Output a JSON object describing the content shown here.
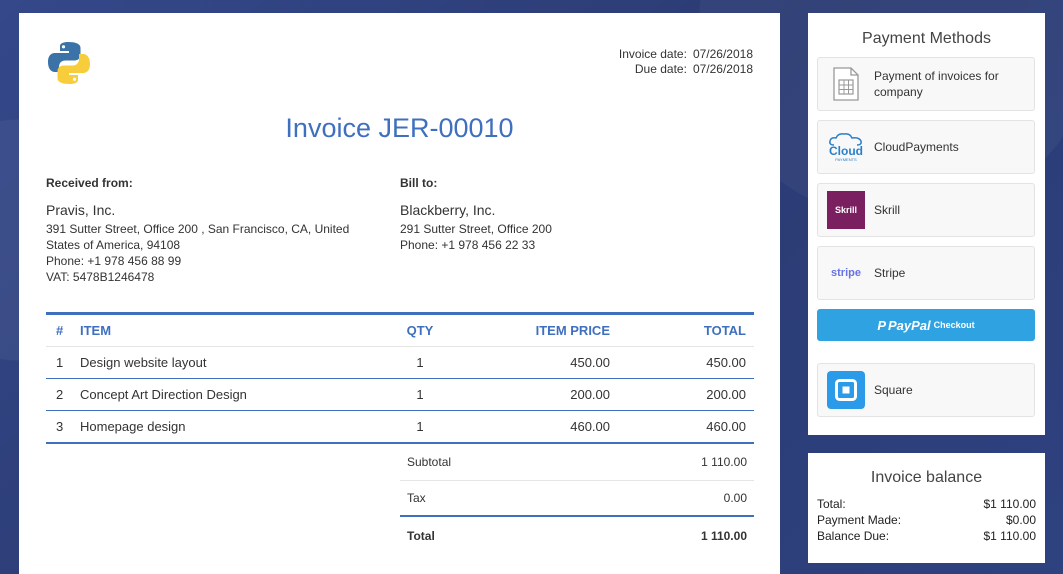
{
  "invoice": {
    "dates": {
      "invoice_label": "Invoice date:",
      "invoice_value": "07/26/2018",
      "due_label": "Due date:",
      "due_value": "07/26/2018"
    },
    "title": "Invoice JER-00010",
    "from": {
      "heading": "Received from:",
      "name": "Pravis, Inc.",
      "address": "391 Sutter Street, Office 200 , San Francisco, CA, United States of America, 94108",
      "phone": "Phone: +1 978 456 88 99",
      "vat": "VAT: 5478B1246478"
    },
    "to": {
      "heading": "Bill to:",
      "name": "Blackberry, Inc.",
      "address": "291 Sutter Street, Office 200",
      "phone": "Phone: +1 978 456 22 33"
    },
    "columns": {
      "num": "#",
      "item": "ITEM",
      "qty": "QTY",
      "price": "ITEM PRICE",
      "total": "TOTAL"
    },
    "rows": [
      {
        "num": "1",
        "item": "Design website layout",
        "qty": "1",
        "price": "450.00",
        "total": "450.00"
      },
      {
        "num": "2",
        "item": "Concept Art Direction Design",
        "qty": "1",
        "price": "200.00",
        "total": "200.00"
      },
      {
        "num": "3",
        "item": "Homepage design",
        "qty": "1",
        "price": "460.00",
        "total": "460.00"
      }
    ],
    "totals": {
      "subtotal_label": "Subtotal",
      "subtotal_value": "1 110.00",
      "tax_label": "Tax",
      "tax_value": "0.00",
      "total_label": "Total",
      "total_value": "1 110.00"
    }
  },
  "payment_methods": {
    "title": "Payment Methods",
    "items": [
      {
        "label": "Payment of invoices for company",
        "icon": "invoice-document-icon"
      },
      {
        "label": "CloudPayments",
        "icon": "cloudpayments-logo-icon",
        "logo_text": "Cloud",
        "logo_sub": "PAYMENTS"
      },
      {
        "label": "Skrill",
        "icon": "skrill-logo-icon",
        "logo_text": "Skrill"
      },
      {
        "label": "Stripe",
        "icon": "stripe-logo-icon",
        "logo_text": "stripe"
      },
      {
        "label": "Square",
        "icon": "square-logo-icon"
      }
    ],
    "paypal": {
      "brand": "PayPal",
      "suffix": "Checkout"
    }
  },
  "balance": {
    "title": "Invoice balance",
    "rows": [
      {
        "label": "Total:",
        "value": "$1 110.00"
      },
      {
        "label": "Payment Made:",
        "value": "$0.00"
      },
      {
        "label": "Balance Due:",
        "value": "$1 110.00"
      }
    ]
  },
  "colors": {
    "accent": "#3f6fbf",
    "paypal": "#2fa3e2",
    "skrill": "#7a1f5f",
    "square": "#2b9ae8",
    "background": "#2e3f7a"
  }
}
